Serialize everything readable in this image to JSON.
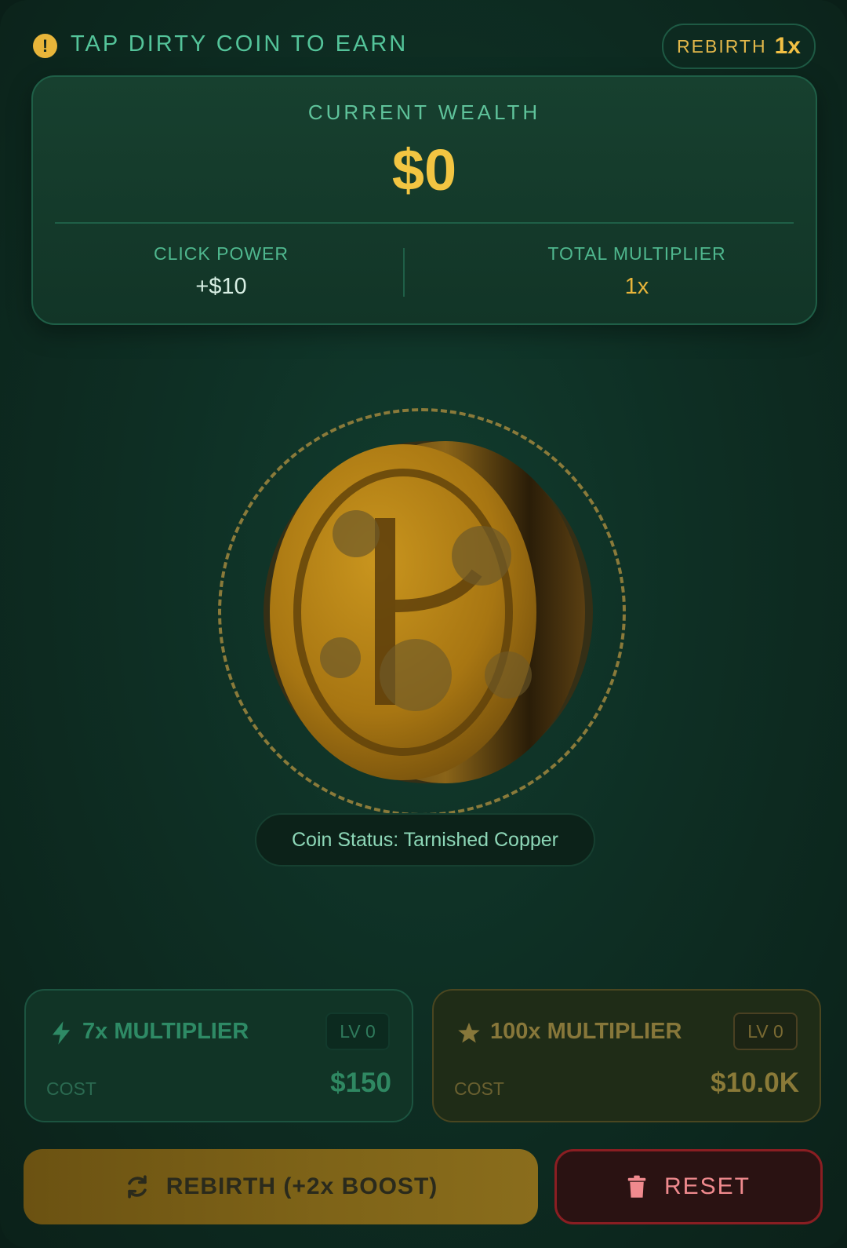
{
  "header": {
    "hint": "TAP DIRTY COIN TO EARN",
    "rebirth_label": "REBIRTH",
    "rebirth_value": "1x"
  },
  "wealth": {
    "title": "CURRENT WEALTH",
    "value": "$0",
    "click_power_label": "CLICK POWER",
    "click_power_value": "+$10",
    "multiplier_label": "TOTAL MULTIPLIER",
    "multiplier_value": "1x"
  },
  "coin": {
    "status": "Coin Status: Tarnished Copper"
  },
  "upgrades": [
    {
      "icon": "lightning-icon",
      "title": "7x MULTIPLIER",
      "level": "LV 0",
      "cost_label": "COST",
      "cost": "$150"
    },
    {
      "icon": "star-icon",
      "title": "100x MULTIPLIER",
      "level": "LV 0",
      "cost_label": "COST",
      "cost": "$10.0K"
    }
  ],
  "buttons": {
    "rebirth": "REBIRTH (+2x BOOST)",
    "reset": "RESET"
  },
  "colors": {
    "gold": "#f2c542",
    "accent_green": "#54c49a",
    "danger": "#8a1e22"
  }
}
